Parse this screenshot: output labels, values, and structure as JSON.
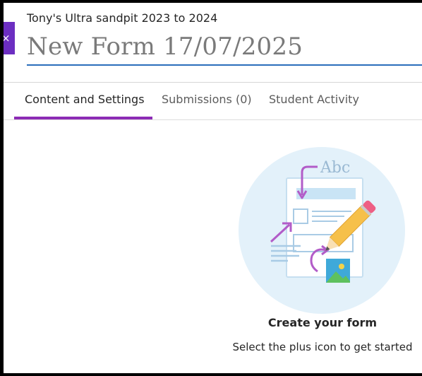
{
  "header": {
    "close_glyph": "×",
    "course_name": "Tony's Ultra sandpit 2023 to 2024",
    "form_title": "New Form 17/07/2025"
  },
  "tabs": [
    {
      "label": "Content and Settings",
      "active": true
    },
    {
      "label": "Submissions (0)",
      "active": false
    },
    {
      "label": "Student Activity",
      "active": false
    }
  ],
  "empty_state": {
    "illustration_text": "Abc",
    "title": "Create your form",
    "subtitle": "Select the plus icon to get started"
  },
  "colors": {
    "accent_purple": "#8c2bb5",
    "close_button": "#6c2ec1",
    "title_underline": "#2a6ebb",
    "illustration_bg": "#e3f1fa"
  }
}
